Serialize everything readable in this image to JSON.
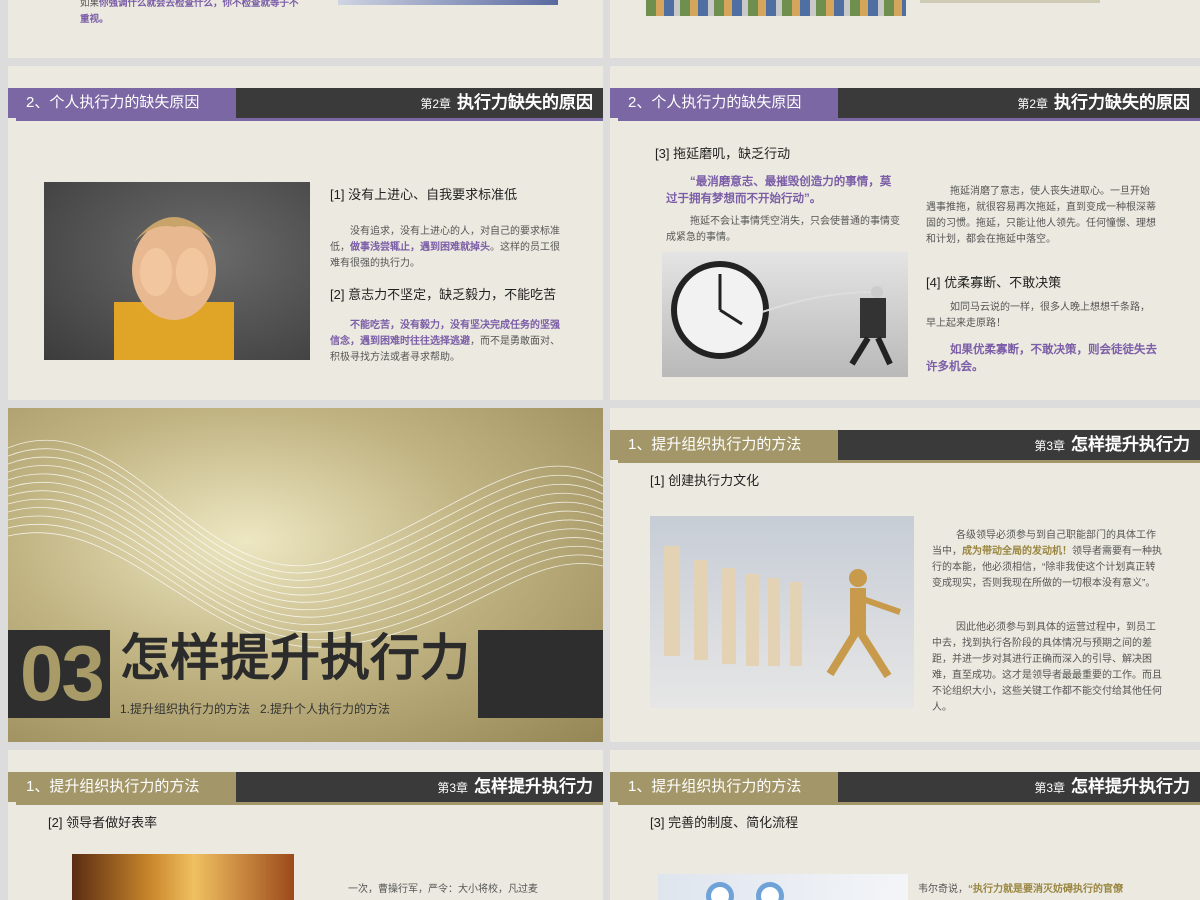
{
  "top_left": {
    "text_a": "如果",
    "text_b": "你强调什么就会去检查什么，你不检查就等于不",
    "text_c": "重视。"
  },
  "ch2": {
    "section": "2、个人执行力的缺失原因",
    "chapter_no": "第2章",
    "chapter_title": "执行力缺失的原因"
  },
  "slide_c": {
    "h1": "[1] 没有上进心、自我要求标准低",
    "p1a": "没有追求，没有上进心的人，对自己的要求标准低，",
    "p1b": "做事浅尝辄止，遇到困难就掉头",
    "p1c": "。这样的员工很难有很强的执行力。",
    "h2": "[2] 意志力不坚定，缺乏毅力，不能吃苦",
    "p2a": "不能吃苦，没有毅力，没有坚决完成任务的坚强信念，遇到困难时往往选择逃避",
    "p2b": "，而不是勇敢面对、积极寻找方法或者寻求帮助。"
  },
  "slide_d": {
    "h3": "[3] 拖延磨叽，缺乏行动",
    "quote": "“最消磨意志、最摧毁创造力的事情，莫过于拥有梦想而不开始行动”。",
    "p3": "拖延不会让事情凭空消失，只会使普通的事情变成紧急的事情。",
    "p3r": "拖延消磨了意志，使人丧失进取心。一旦开始遇事推拖，就很容易再次拖延，直到变成一种根深蒂固的习惯。拖延，只能让他人领先。任何憧憬、理想和计划，都会在拖延中落空。",
    "h4": "[4] 优柔寡断、不敢决策",
    "p4": "如同马云说的一样，很多人晚上想想千条路，早上起来走原路！",
    "p4hl": "如果优柔寡断，不敢决策，则会徒徒失去许多机会。"
  },
  "cover": {
    "number": "03",
    "title": "怎样提升执行力",
    "subtitle": "1.提升组织执行力的方法   2.提升个人执行力的方法"
  },
  "ch3": {
    "section": "1、提升组织执行力的方法",
    "chapter_no": "第3章",
    "chapter_title": "怎样提升执行力"
  },
  "slide_f": {
    "h1": "[1] 创建执行力文化",
    "p1a": "各级领导必须参与到自己职能部门的具体工作当中，",
    "p1hl": "成为带动全局的发动机！",
    "p1b": "领导者需要有一种执行的本能，他必须相信，“除非我使这个计划真正转变成现实，否则我现在所做的一切根本没有意义”。",
    "p2": "因此他必须参与到具体的运营过程中，到员工中去，找到执行各阶段的具体情况与预期之间的差距，并进一步对其进行正确而深入的引导、解决困难，直至成功。这才是领导者最最重要的工作。而且不论组织大小，这些关键工作都不能交付给其他任何人。"
  },
  "slide_g": {
    "h2": "[2] 领导者做好表率",
    "p": "一次，曹操行军，严令：大小将校，凡过麦"
  },
  "slide_h": {
    "h3": "[3] 完善的制度、简化流程",
    "p_a": "韦尔奇说，",
    "p_hl": "“执行力就是要消灭妨碍执行的官僚"
  },
  "colors": {
    "purple": "#7b67a3",
    "gold": "#a3976a",
    "dark": "#3a3a3a",
    "bg": "#eceae0"
  }
}
